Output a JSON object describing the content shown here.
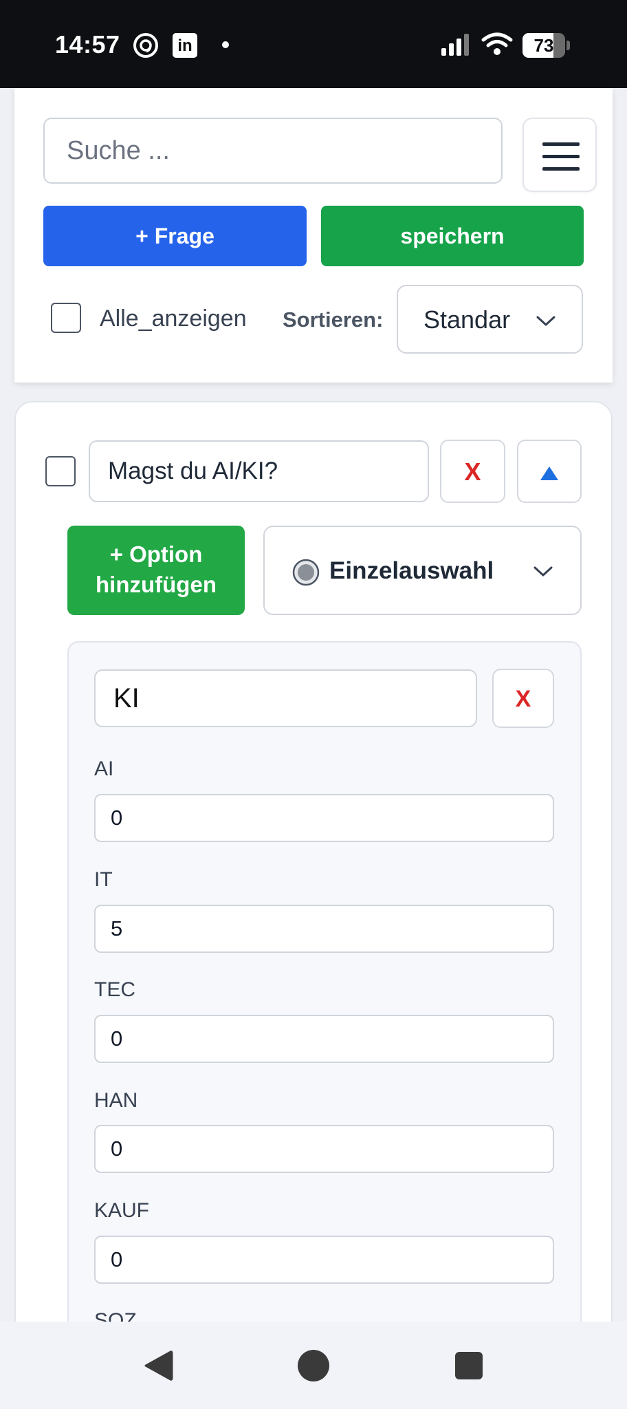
{
  "status_bar": {
    "time": "14:57",
    "notification_icons": [
      "threads-icon",
      "linkedin-icon",
      "dot-icon"
    ],
    "linkedin_glyph": "in",
    "battery_percent": 73,
    "battery_label": "73"
  },
  "toolbar": {
    "search_placeholder": "Suche ...",
    "add_question_label": "+ Frage",
    "save_label": "speichern",
    "show_all_label": "Alle_anzeigen",
    "show_all_checked": false,
    "sort_label": "Sortieren:",
    "sort_value": "Standar"
  },
  "question": {
    "checked": false,
    "text": "Magst du AI/KI?",
    "delete_label": "X",
    "collapse_label": "▲",
    "add_option_label": "+ Option hinzufügen",
    "type_icon": "radio-icon",
    "type_value": "Einzelauswahl",
    "options": [
      {
        "text": "KI",
        "delete_label": "X",
        "scores": [
          {
            "label": "AI",
            "value": "0"
          },
          {
            "label": "IT",
            "value": "5"
          },
          {
            "label": "TEC",
            "value": "0"
          },
          {
            "label": "HAN",
            "value": "0"
          },
          {
            "label": "KAUF",
            "value": "0"
          },
          {
            "label": "SOZ",
            "value": ""
          }
        ]
      }
    ]
  },
  "colors": {
    "primary_blue": "#2563eb",
    "success_green": "#16a34a",
    "danger_red": "#dc2626"
  },
  "nav_bar": {
    "icons": [
      "back-icon",
      "home-icon",
      "recents-icon"
    ]
  }
}
